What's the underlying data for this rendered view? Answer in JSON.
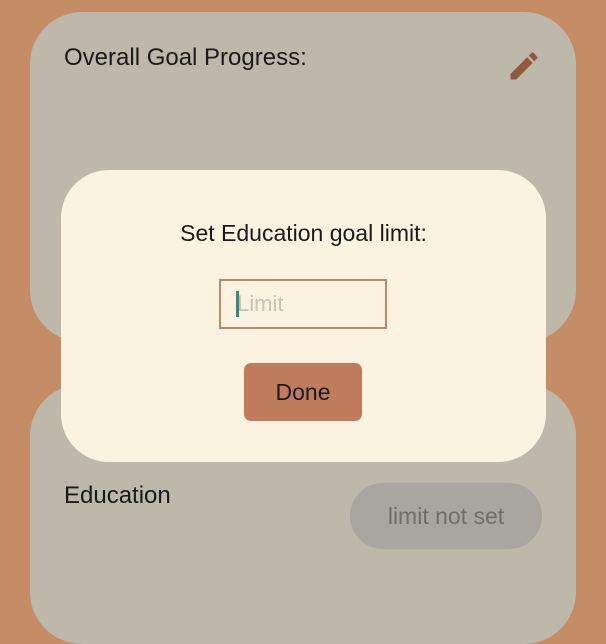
{
  "overall_card": {
    "title": "Overall Goal Progress:",
    "edit_icon": "pencil-icon"
  },
  "goals_card": {
    "goal_label": "Education",
    "limit_status": "limit not set"
  },
  "dialog": {
    "title": "Set Education goal limit:",
    "input_value": "",
    "input_placeholder": "Limit",
    "done_label": "Done"
  },
  "colors": {
    "background": "#c48d66",
    "card": "#bdb8a9",
    "dialog": "#fbf3e0",
    "accent": "#bf7d5e",
    "edit_icon": "#8f5a3e",
    "pill": "#a8a69f"
  }
}
